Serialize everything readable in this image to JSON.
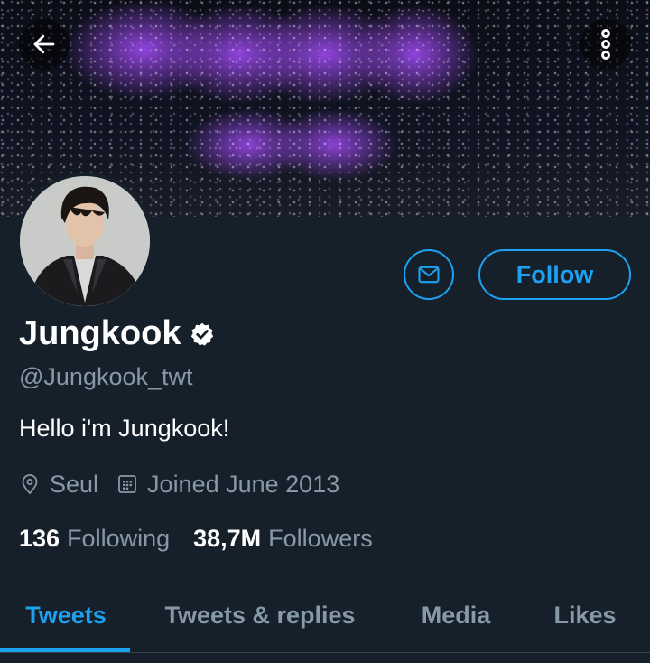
{
  "header": {
    "back_icon": "arrow-left-icon",
    "more_icon": "more-vertical-icon",
    "banner_description_color": "#8a3ee0"
  },
  "profile": {
    "display_name": "Jungkook",
    "verified_icon": "verified-badge-icon",
    "handle": "@Jungkook_twt",
    "bio": "Hello i'm Jungkook!",
    "location_icon": "location-pin-icon",
    "location": "Seul",
    "joined_icon": "calendar-icon",
    "joined": "Joined June 2013"
  },
  "actions": {
    "message_icon": "mail-icon",
    "follow_label": "Follow"
  },
  "stats": {
    "following_count": "136",
    "following_label": "Following",
    "followers_count": "38,7M",
    "followers_label": "Followers"
  },
  "tabs": [
    {
      "label": "Tweets",
      "active": true
    },
    {
      "label": "Tweets & replies",
      "active": false
    },
    {
      "label": "Media",
      "active": false
    },
    {
      "label": "Likes",
      "active": false
    }
  ],
  "colors": {
    "background": "#15202b",
    "accent": "#1da1f2",
    "secondary_text": "#8899a6",
    "divider": "#38444d"
  }
}
